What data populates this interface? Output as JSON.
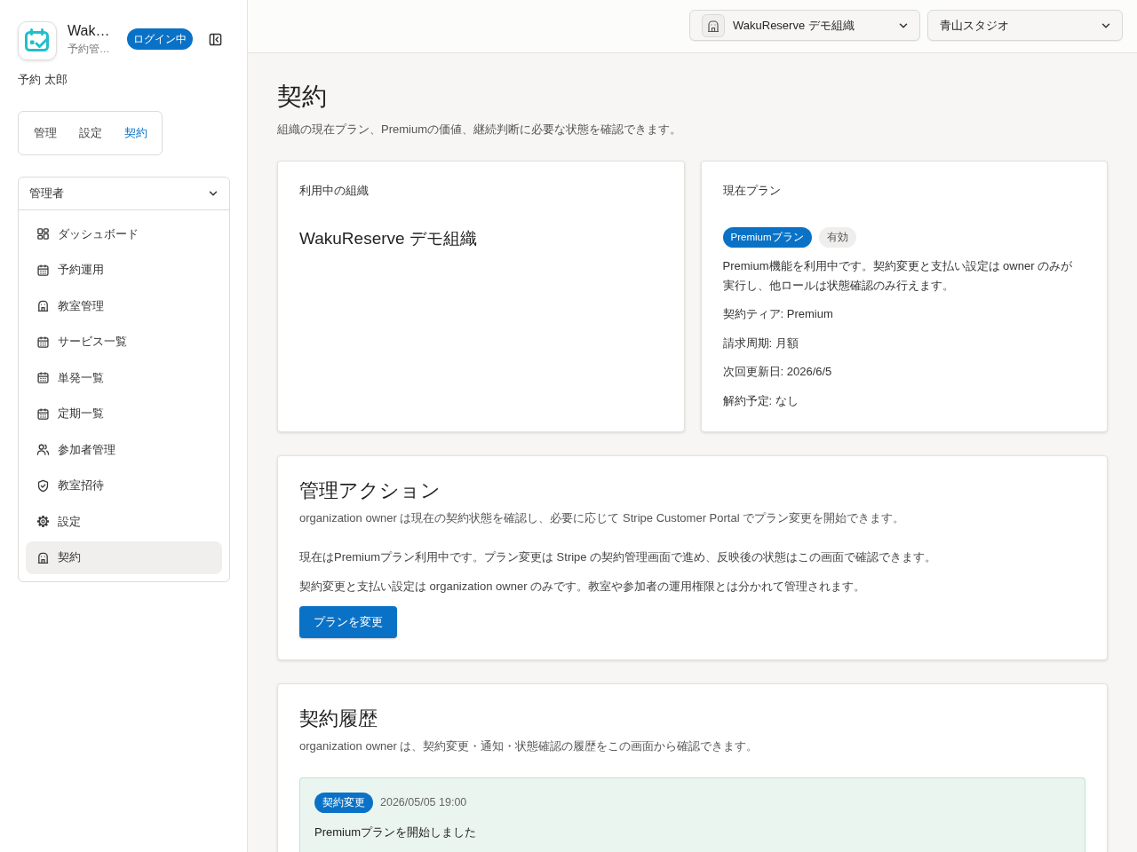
{
  "sidebar": {
    "app_title": "Wak…",
    "app_subtitle": "予約管…",
    "status_badge": "ログイン中",
    "user_name": "予約 太郎",
    "tabs": [
      {
        "label": "管理",
        "selected": false
      },
      {
        "label": "設定",
        "selected": false
      },
      {
        "label": "契約",
        "selected": true
      }
    ],
    "section": {
      "title": "管理者",
      "expanded": true,
      "items": [
        {
          "label": "ダッシュボード",
          "kind": "dashboard",
          "selected": false
        },
        {
          "label": "予約運用",
          "kind": "calendar",
          "selected": false
        },
        {
          "label": "教室管理",
          "kind": "building",
          "selected": false
        },
        {
          "label": "サービス一覧",
          "kind": "calendar",
          "selected": false
        },
        {
          "label": "単発一覧",
          "kind": "calendar",
          "selected": false
        },
        {
          "label": "定期一覧",
          "kind": "calendar",
          "selected": false
        },
        {
          "label": "参加者管理",
          "kind": "users",
          "selected": false
        },
        {
          "label": "教室招待",
          "kind": "shield",
          "selected": false
        },
        {
          "label": "設定",
          "kind": "gear",
          "selected": false
        },
        {
          "label": "契約",
          "kind": "building",
          "selected": true
        }
      ]
    }
  },
  "header": {
    "organization_select": {
      "value": "WakuReserve デモ組織"
    },
    "studio_select": {
      "value": "青山スタジオ"
    }
  },
  "page": {
    "title": "契約",
    "subtitle": "組織の現在プラン、Premiumの価値、継続判断に必要な状態を確認できます。"
  },
  "organization_card": {
    "label": "利用中の組織",
    "value": "WakuReserve デモ組織"
  },
  "plan_card": {
    "label": "現在プラン",
    "badges": [
      {
        "text": "Premiumプラン",
        "kind": "primary"
      },
      {
        "text": "有効",
        "kind": "neutral"
      }
    ],
    "description": "Premium機能を利用中です。契約変更と支払い設定は owner のみが実行し、他ロールは状態確認のみ行えます。",
    "details": [
      "契約ティア: Premium",
      "請求周期: 月額",
      "次回更新日: 2026/6/5",
      "解約予定: なし"
    ]
  },
  "actions_card": {
    "title": "管理アクション",
    "description": "organization owner は現在の契約状態を確認し、必要に応じて Stripe Customer Portal でプラン変更を開始できます。",
    "notes": [
      "現在はPremiumプラン利用中です。プラン変更は Stripe の契約管理画面で進め、反映後の状態はこの画面で確認できます。",
      "契約変更と支払い設定は organization owner のみです。教室や参加者の運用権限とは分かれて管理されます。"
    ],
    "button": "プランを変更"
  },
  "history_card": {
    "title": "契約履歴",
    "description": "organization owner は、契約変更・通知・状態確認の履歴をこの画面から確認できます。",
    "entries": [
      {
        "tag": "契約変更",
        "time": "2026/05/05 19:00",
        "title": "Premiumプランを開始しました"
      }
    ]
  }
}
